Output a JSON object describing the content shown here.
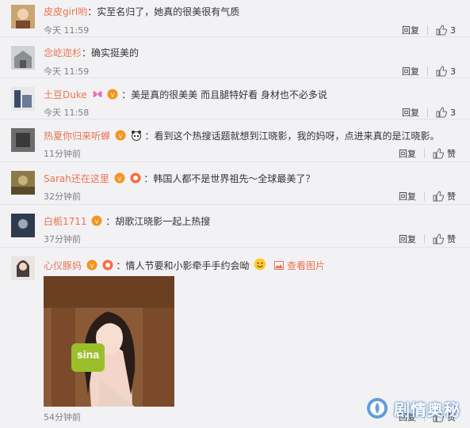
{
  "comments": [
    {
      "user": "皮皮girl哟",
      "text": "实至名归了，她真的很美很有气质",
      "time": "今天 11:59",
      "reply": "回复",
      "likes": "3"
    },
    {
      "user": "念屹迩杉",
      "text": "确实挺美的",
      "time": "今天 11:59",
      "reply": "回复",
      "likes": "3"
    },
    {
      "user": "土豆Duke",
      "text": "美是真的很美美 而且腿特好看 身材也不必多说",
      "time": "今天 11:58",
      "reply": "回复",
      "likes": "3"
    },
    {
      "user": "热夏你归来听蝉",
      "text": "看到这个热搜话题就想到江晓影，我的妈呀，点进来真的是江晓影。",
      "time": "11分钟前",
      "reply": "回复",
      "likes": "赞"
    },
    {
      "user": "Sarah还在这里",
      "text": "韩国人都不是世界祖先～全球最美了？",
      "time": "32分钟前",
      "reply": "回复",
      "likes": "赞"
    },
    {
      "user": "白栀1711",
      "text": "胡歌江晓影一起上热搜",
      "time": "37分钟前",
      "reply": "回复",
      "likes": "赞"
    },
    {
      "user": "心仪豚妈",
      "text": "情人节要和小影牵手手约会呦",
      "time": "54分钟前",
      "reply": "回复",
      "likes": "赞",
      "photo_link": "查看图片"
    }
  ],
  "watermark": "剧情奥秘",
  "colors": {
    "username": "#eb7350",
    "background": "#f2f2f5"
  }
}
